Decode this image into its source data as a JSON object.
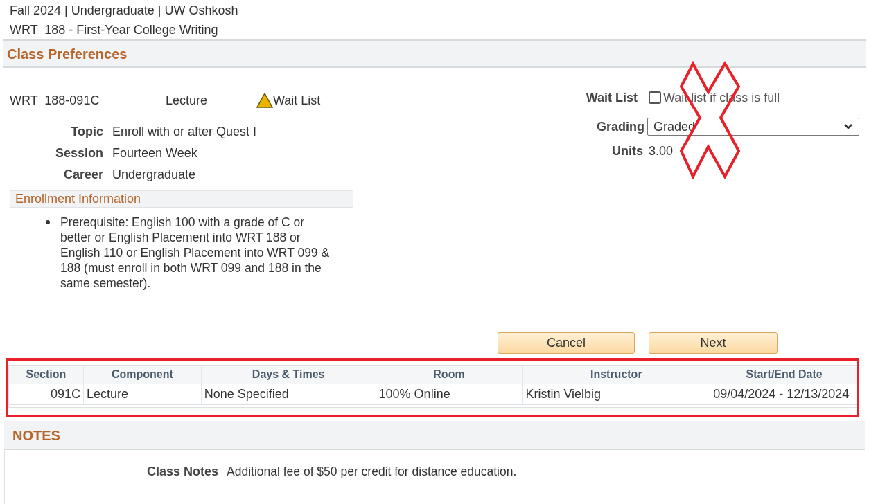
{
  "header": {
    "term_line": "Fall 2024 | Undergraduate | UW Oshkosh",
    "course_title": "WRT  188 - First-Year College Writing"
  },
  "section_title": "Class Preferences",
  "class_info": {
    "section": "WRT  188-091C",
    "component": "Lecture",
    "status": {
      "kind": "wait_list",
      "label": "Wait List"
    }
  },
  "details": [
    {
      "label": "Topic",
      "value": "Enroll with or after Quest I"
    },
    {
      "label": "Session",
      "value": "Fourteen Week"
    },
    {
      "label": "Career",
      "value": "Undergraduate"
    }
  ],
  "enrollment_info": {
    "title": "Enrollment Information",
    "items": [
      "Prerequisite: English 100 with a grade of C or better or English Placement into WRT 188 or English 110 or English Placement into WRT 099 & 188 (must enroll in both WRT 099 and 188 in the same semester)."
    ]
  },
  "preferences": {
    "wait_list": {
      "label": "Wait List",
      "option_label": "Wait list if class is full",
      "checked": false
    },
    "grading": {
      "label": "Grading",
      "value": "Graded"
    },
    "units": {
      "label": "Units",
      "value": "3.00"
    }
  },
  "buttons": [
    "Cancel",
    "Next"
  ],
  "table": {
    "columns": [
      "Section",
      "Component",
      "Days & Times",
      "Room",
      "Instructor",
      "Start/End Date"
    ],
    "rows": [
      [
        "091C",
        "Lecture",
        "None Specified",
        "100% Online",
        "Kristin Vielbig",
        "09/04/2024 - 12/13/2024"
      ]
    ]
  },
  "notes": {
    "title": "NOTES",
    "items": [
      {
        "label": "Class Notes",
        "value": "Additional fee of $50 per credit for distance education."
      }
    ]
  },
  "annotations": {
    "cross": {
      "color": "#e8202a"
    },
    "highlight_box": {
      "color": "#e8202a"
    }
  }
}
